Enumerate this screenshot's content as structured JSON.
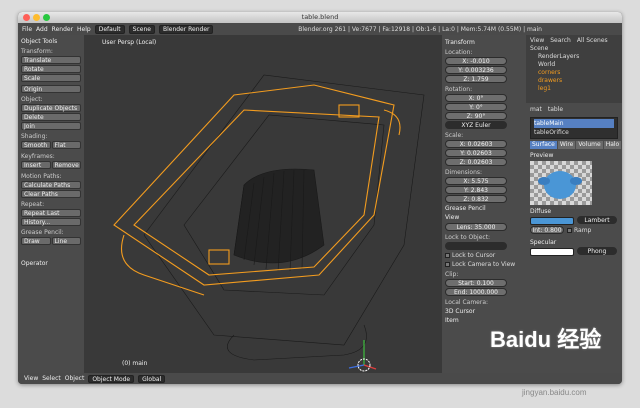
{
  "window": {
    "title": "table.blend"
  },
  "menubar": {
    "file": "File",
    "add": "Add",
    "render": "Render",
    "help": "Help",
    "layout": "Default",
    "scene": "Scene",
    "engine": "Blender Render",
    "stats": "Blender.org 261 | Ve:7677 | Fa:12918 | Ob:1-6 | La:0 | Mem:5.74M (0.55M) | main"
  },
  "toolshelf": {
    "title": "Object Tools",
    "transform_label": "Transform:",
    "translate": "Translate",
    "rotate": "Rotate",
    "scale": "Scale",
    "origin": "Origin",
    "object_label": "Object:",
    "duplicate": "Duplicate Objects",
    "delete": "Delete",
    "join": "Join",
    "shading_label": "Shading:",
    "smooth": "Smooth",
    "flat": "Flat",
    "keyframes_label": "Keyframes:",
    "insert": "Insert",
    "remove": "Remove",
    "motion_label": "Motion Paths:",
    "calc_paths": "Calculate Paths",
    "clear_paths": "Clear Paths",
    "repeat_label": "Repeat:",
    "repeat_last": "Repeat Last",
    "history": "History...",
    "grease_label": "Grease Pencil:",
    "draw": "Draw",
    "line": "Line",
    "operator": "Operator"
  },
  "viewport": {
    "label": "User Persp (Local)",
    "object": "(0) main"
  },
  "nprops": {
    "transform": "Transform",
    "location": "Location:",
    "loc": [
      "X: -0.010",
      "Y: 0.003236",
      "Z: 1.759"
    ],
    "rotation": "Rotation:",
    "rot": [
      "X: 0°",
      "Y: 0°",
      "Z: 90°"
    ],
    "rot_mode": "XYZ Euler",
    "scale": "Scale:",
    "scl": [
      "X: 0.02603",
      "Y: 0.02603",
      "Z: 0.02603"
    ],
    "dimensions": "Dimensions:",
    "dim": [
      "X: 5.575",
      "Y: 2.843",
      "Z: 0.832"
    ],
    "grease": "Grease Pencil",
    "view": "View",
    "lens": "Lens: 35.000",
    "lock_obj": "Lock to Object:",
    "lock_cursor": "Lock to Cursor",
    "lock_camera": "Lock Camera to View",
    "clip": "Clip:",
    "start": "Start: 0.100",
    "end": "End: 1000.000",
    "local_camera": "Local Camera:",
    "cursor3d": "3D Cursor",
    "item": "Item"
  },
  "outliner": {
    "view": "View",
    "search": "Search",
    "all_scenes": "All Scenes",
    "scene": "Scene",
    "render_layers": "RenderLayers",
    "world": "World",
    "items": [
      "corners",
      "drawers",
      "leg1"
    ]
  },
  "props": {
    "crumb_mat": "mat",
    "crumb_table": "table",
    "materials": [
      "tableMain",
      "tableOrifice"
    ],
    "tabs": [
      "Surface",
      "Wire",
      "Volume",
      "Halo"
    ],
    "preview": "Preview",
    "diffuse": "Diffuse",
    "diffuse_shader": "Lambert",
    "intensity": "Int: 0.800",
    "ramp": "Ramp",
    "specular": "Specular",
    "spec_shader": "Phong"
  },
  "bottombar": {
    "view": "View",
    "select": "Select",
    "object": "Object",
    "mode": "Object Mode",
    "orientation": "Global"
  },
  "watermark": {
    "logo": "Baidu 经验",
    "url": "jingyan.baidu.com"
  },
  "colors": {
    "selection": "#f39c1f",
    "accent": "#5680c2",
    "material": "#4a96d6"
  }
}
